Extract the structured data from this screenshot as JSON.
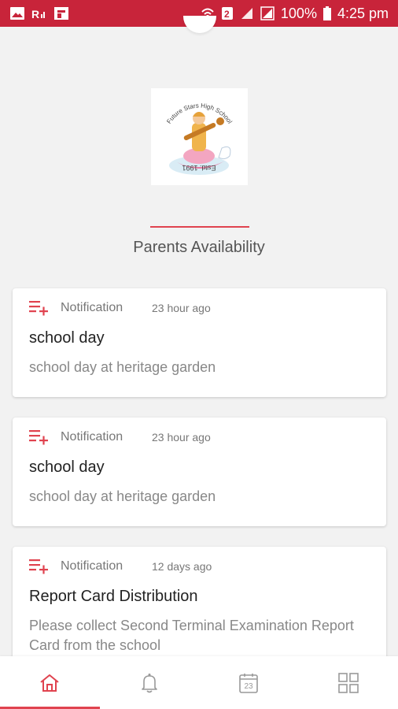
{
  "status_bar": {
    "left_icons": [
      "image-icon",
      "signal-alt-icon",
      "flipboard-icon"
    ],
    "right_icons": [
      "wifi-icon",
      "sim-2-icon",
      "signal-icon",
      "signal-alt-icon",
      "battery-icon"
    ],
    "battery": "100%",
    "time": "4:25 pm",
    "bg_color": "#c8243a"
  },
  "school": {
    "logo_text_top": "Future Stars High School",
    "logo_text_bottom": "Estd. 1991"
  },
  "section_title": "Parents Availability",
  "accent_color": "#e0434f",
  "notifications": [
    {
      "type": "Notification",
      "time": "23 hour ago",
      "title": "school day",
      "description": "school day at heritage garden"
    },
    {
      "type": "Notification",
      "time": "23 hour ago",
      "title": "school day",
      "description": "school day at heritage garden"
    },
    {
      "type": "Notification",
      "time": "12 days ago",
      "title": "Report Card Distribution",
      "description": "Please collect Second Terminal Examination Report Card from the school"
    }
  ],
  "bottom_nav": {
    "items": [
      {
        "icon": "home-icon",
        "active": true
      },
      {
        "icon": "bell-icon",
        "active": false
      },
      {
        "icon": "calendar-icon",
        "active": false
      },
      {
        "icon": "grid-icon",
        "active": false
      }
    ],
    "calendar_day": "23"
  }
}
